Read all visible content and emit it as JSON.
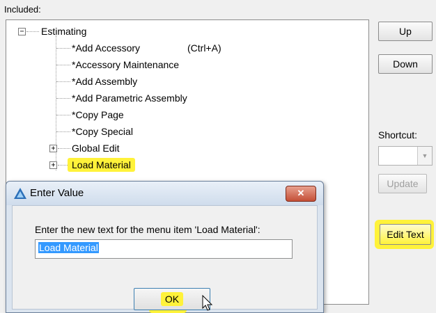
{
  "included_label": "Included:",
  "tree": {
    "root": {
      "label": "Estimating",
      "expander": "−"
    },
    "items": [
      {
        "label": "*Add Accessory",
        "shortcut": "(Ctrl+A)"
      },
      {
        "label": "*Accessory Maintenance"
      },
      {
        "label": "*Add Assembly"
      },
      {
        "label": "*Add Parametric Assembly"
      },
      {
        "label": "*Copy Page"
      },
      {
        "label": "*Copy Special"
      },
      {
        "label": "Global Edit",
        "expander": "+"
      },
      {
        "label": "Load Material",
        "expander": "+",
        "highlighted": true
      }
    ]
  },
  "buttons": {
    "up": "Up",
    "down": "Down",
    "update": "Update",
    "edit_text": "Edit Text"
  },
  "shortcut": {
    "label": "Shortcut:",
    "value": ""
  },
  "dialog": {
    "title": "Enter Value",
    "close_glyph": "✕",
    "prompt": "Enter the new text for the menu item 'Load Material':",
    "input_value": "Load Material",
    "ok": "OK"
  },
  "colors": {
    "highlight": "#fff23a",
    "selection": "#3399ff"
  }
}
